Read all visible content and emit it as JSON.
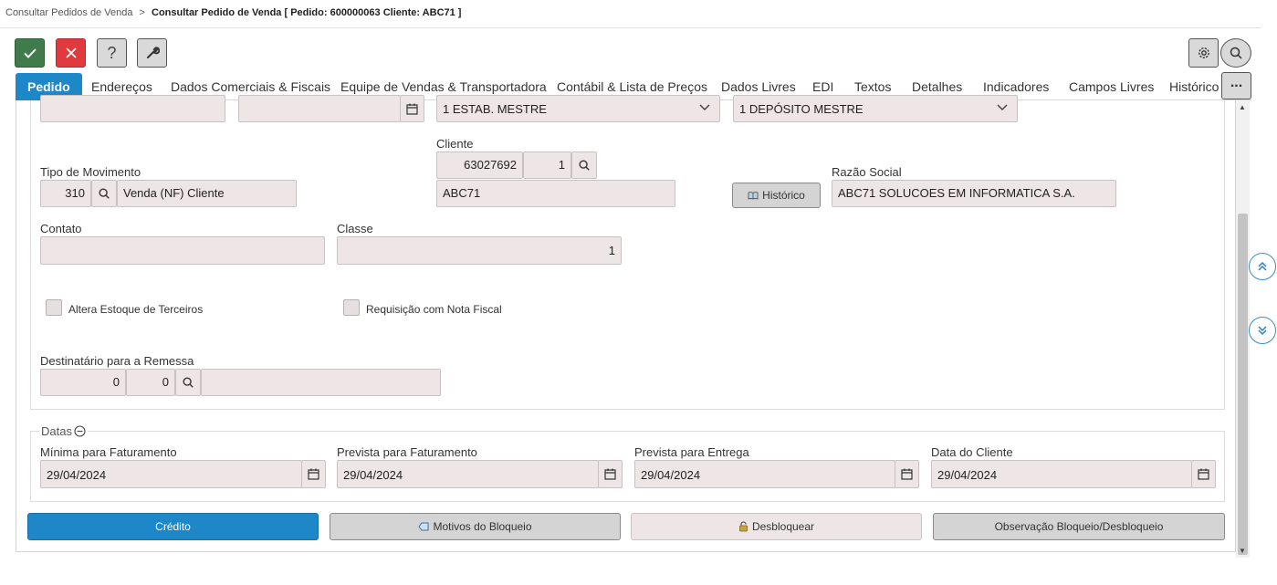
{
  "breadcrumb": {
    "parent": "Consultar Pedidos de Venda",
    "separator": ">",
    "current": "Consultar Pedido de Venda [ Pedido: 600000063 Cliente: ABC71 ]"
  },
  "toolbar": {
    "help_label": "?"
  },
  "tabs": [
    "Pedido",
    "Endereços",
    "Dados Comerciais & Fiscais",
    "Equipe de Vendas & Transportadora",
    "Contábil & Lista de Preços",
    "Dados Livres",
    "EDI",
    "Textos",
    "Detalhes",
    "Indicadores",
    "Campos Livres",
    "Histórico"
  ],
  "more_label": "...",
  "form": {
    "top_field_1": "",
    "top_field_2": "",
    "estabelecimento": "1 ESTAB. MESTRE",
    "deposito": "1 DEPÓSITO MESTRE",
    "cliente_label": "Cliente",
    "cliente_codigo": "63027692",
    "cliente_loja": "1",
    "cliente_nome": "ABC71",
    "tipo_mov_label": "Tipo de Movimento",
    "tipo_mov_codigo": "310",
    "tipo_mov_desc": "Venda (NF) Cliente",
    "historico_btn": "Histórico",
    "razao_label": "Razão Social",
    "razao_value": "ABC71 SOLUCOES EM INFORMATICA S.A.",
    "contato_label": "Contato",
    "contato_value": "",
    "classe_label": "Classe",
    "classe_value": "1",
    "altera_estoque_label": "Altera Estoque de Terceiros",
    "requisicao_label": "Requisição com Nota Fiscal",
    "dest_label": "Destinatário para a Remessa",
    "dest_1": "0",
    "dest_2": "0",
    "dest_nome": ""
  },
  "datas": {
    "legend": "Datas",
    "minima_label": "Mínima para Faturamento",
    "minima_value": "29/04/2024",
    "prev_fat_label": "Prevista para Faturamento",
    "prev_fat_value": "29/04/2024",
    "prev_ent_label": "Prevista para Entrega",
    "prev_ent_value": "29/04/2024",
    "cliente_label": "Data do Cliente",
    "cliente_value": "29/04/2024"
  },
  "actions": {
    "credito": "Crédito",
    "motivos": "Motivos do Bloqueio",
    "desbloquear": "Desbloquear",
    "observacao": "Observação Bloqueio/Desbloqueio"
  },
  "colors": {
    "accent": "#1d87c8",
    "confirm": "#3f7b4b",
    "cancel": "#e0393e",
    "field_bg": "#ede5e6"
  }
}
